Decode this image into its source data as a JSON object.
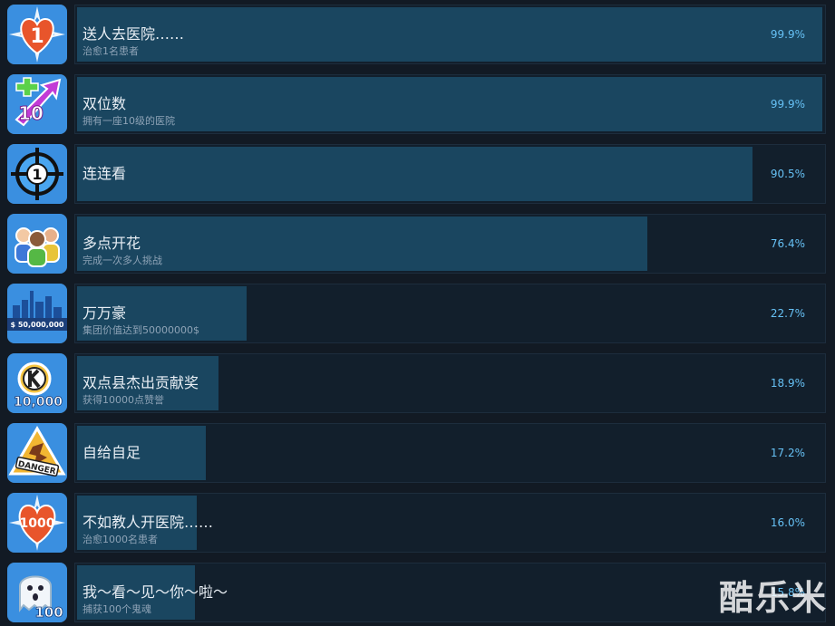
{
  "achievements": [
    {
      "title": "送人去医院……",
      "desc": "治愈1名患者",
      "percent": "99.9%",
      "fill": 99.9,
      "icon": "heart-1-icon"
    },
    {
      "title": "双位数",
      "desc": "拥有一座10级的医院",
      "percent": "99.9%",
      "fill": 99.9,
      "icon": "level-10-arrow-icon"
    },
    {
      "title": "连连看",
      "desc": "",
      "percent": "90.5%",
      "fill": 90.5,
      "icon": "crosshair-1-icon"
    },
    {
      "title": "多点开花",
      "desc": "完成一次多人挑战",
      "percent": "76.4%",
      "fill": 76.4,
      "icon": "multiplayer-people-icon"
    },
    {
      "title": "万万豪",
      "desc": "集团价值达到50000000$",
      "percent": "22.7%",
      "fill": 22.7,
      "icon": "city-50m-icon",
      "icon_text": "$ 50,000,000"
    },
    {
      "title": "双点县杰出贡献奖",
      "desc": "获得10000点赞誉",
      "percent": "18.9%",
      "fill": 18.9,
      "icon": "kudos-10000-icon",
      "icon_text": "10,000"
    },
    {
      "title": "自给自足",
      "desc": "",
      "percent": "17.2%",
      "fill": 17.2,
      "icon": "danger-sign-icon",
      "icon_text": "DANGER"
    },
    {
      "title": "不如教人开医院……",
      "desc": "治愈1000名患者",
      "percent": "16.0%",
      "fill": 16.0,
      "icon": "heart-1000-icon",
      "icon_text": "1000"
    },
    {
      "title": "我～看～见～你～啦～",
      "desc": "捕获100个鬼魂",
      "percent": "15.8%",
      "fill": 15.8,
      "icon": "ghost-100-icon",
      "icon_text": "100"
    }
  ],
  "watermark": "酷乐米",
  "colors": {
    "background": "#121a24",
    "bar_fill": "#1a4660",
    "percent_text": "#66c0f4"
  }
}
